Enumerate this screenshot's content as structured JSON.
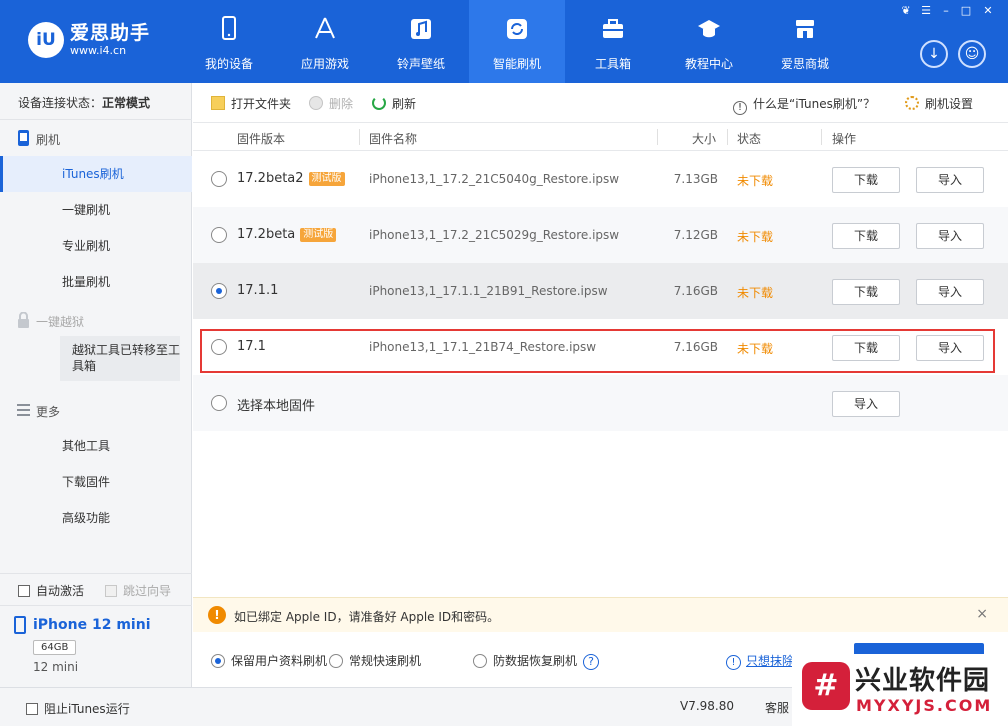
{
  "app": {
    "brand_cn": "爱思助手",
    "brand_url": "www.i4.cn",
    "logo_text": "iU"
  },
  "nav": [
    {
      "label": "我的设备",
      "icon": "phone-icon"
    },
    {
      "label": "应用游戏",
      "icon": "appstore-icon"
    },
    {
      "label": "铃声壁纸",
      "icon": "music-icon"
    },
    {
      "label": "智能刷机",
      "icon": "refresh-icon",
      "active": true
    },
    {
      "label": "工具箱",
      "icon": "toolbox-icon"
    },
    {
      "label": "教程中心",
      "icon": "graduation-cap-icon"
    },
    {
      "label": "爱思商城",
      "icon": "store-icon"
    }
  ],
  "sidebar": {
    "connection_label": "设备连接状态：",
    "connection_value": "正常模式",
    "flash_group": "刷机",
    "items": [
      "iTunes刷机",
      "一键刷机",
      "专业刷机",
      "批量刷机"
    ],
    "jailbreak_group": "一键越狱",
    "jailbreak_note": "越狱工具已转移至工具箱",
    "more_group": "更多",
    "more_items": [
      "其他工具",
      "下载固件",
      "高级功能"
    ],
    "auto_activate": "自动激活",
    "skip_guide": "跳过向导"
  },
  "device": {
    "name": "iPhone 12 mini",
    "capacity": "64GB",
    "model": "12 mini"
  },
  "toolbar": {
    "open_folder": "打开文件夹",
    "delete": "删除",
    "refresh": "刷新",
    "what_is": "什么是“iTunes刷机”？",
    "settings": "刷机设置"
  },
  "table": {
    "headers": {
      "version": "固件版本",
      "name": "固件名称",
      "size": "大小",
      "status": "状态",
      "action": "操作"
    },
    "rows": [
      {
        "version": "17.2beta2",
        "beta": "测试版",
        "name": "iPhone13,1_17.2_21C5040g_Restore.ipsw",
        "size": "7.13GB",
        "status": "未下载",
        "download": "下载",
        "import": "导入"
      },
      {
        "version": "17.2beta",
        "beta": "测试版",
        "name": "iPhone13,1_17.2_21C5029g_Restore.ipsw",
        "size": "7.12GB",
        "status": "未下载",
        "download": "下载",
        "import": "导入"
      },
      {
        "version": "17.1.1",
        "beta": "",
        "name": "iPhone13,1_17.1.1_21B91_Restore.ipsw",
        "size": "7.16GB",
        "status": "未下载",
        "download": "下载",
        "import": "导入"
      },
      {
        "version": "17.1",
        "beta": "",
        "name": "iPhone13,1_17.1_21B74_Restore.ipsw",
        "size": "7.16GB",
        "status": "未下载",
        "download": "下载",
        "import": "导入"
      }
    ],
    "local": {
      "label": "选择本地固件",
      "import": "导入"
    }
  },
  "notice": {
    "text": "如已绑定 Apple ID，请准备好 Apple ID和密码。",
    "close": "×"
  },
  "options": {
    "keep_data": "保留用户资料刷机",
    "quick": "常规快速刷机",
    "anti_recovery": "防数据恢复刷机",
    "help": "?",
    "link": "只想抹除"
  },
  "statusbar": {
    "block_itunes": "阻止iTunes运行",
    "version": "V7.98.80",
    "service": "客服"
  },
  "watermark": {
    "icon_text": "#",
    "cn": "兴业软件园",
    "url": "MYXYJS.COM"
  },
  "colors": {
    "primary": "#1a63d8",
    "warning": "#f08a00",
    "highlight": "#e53935"
  }
}
